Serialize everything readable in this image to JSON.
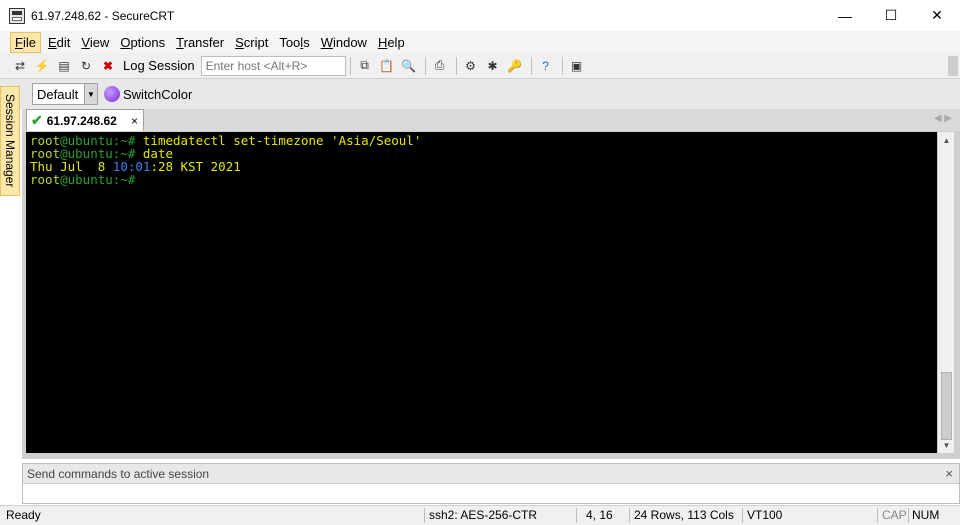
{
  "window": {
    "title": "61.97.248.62 - SecureCRT",
    "minimize": "—",
    "maximize": "☐",
    "close": "✕"
  },
  "menu": [
    {
      "label": "File",
      "underline": "F",
      "rest": "ile"
    },
    {
      "label": "Edit",
      "underline": "E",
      "rest": "dit"
    },
    {
      "label": "View",
      "underline": "V",
      "rest": "iew"
    },
    {
      "label": "Options",
      "underline": "O",
      "rest": "ptions"
    },
    {
      "label": "Transfer",
      "underline": "T",
      "rest": "ransfer"
    },
    {
      "label": "Script",
      "underline": "S",
      "rest": "cript"
    },
    {
      "label": "Tools",
      "underline": "l",
      "rest": ""
    },
    {
      "label": "Window",
      "underline": "W",
      "rest": "indow"
    },
    {
      "label": "Help",
      "underline": "H",
      "rest": "elp"
    }
  ],
  "toolbar": {
    "log_session": "Log Session",
    "host_placeholder": "Enter host <Alt+R>"
  },
  "buttonbar": {
    "default_label": "Default",
    "switchcolor": "SwitchColor"
  },
  "side": {
    "session_manager": "Session Manager"
  },
  "tab": {
    "label": "61.97.248.62",
    "close": "×"
  },
  "terminal": {
    "lines": [
      {
        "user": "root",
        "host": "@ubuntu:~#",
        "cmd": " timedatectl set-timezone 'Asia/Seoul'"
      },
      {
        "user": "root",
        "host": "@ubuntu:~#",
        "cmd": " date"
      },
      {
        "date_pre": "Thu Jul  8 ",
        "date_time": "10:01",
        "date_post": ":28 KST 2021"
      },
      {
        "user": "root",
        "host": "@ubuntu:~#",
        "cmd": ""
      }
    ]
  },
  "command_window": {
    "header": "Send commands to active session",
    "close": "×"
  },
  "status": {
    "ready": "Ready",
    "cipher": "ssh2: AES-256-CTR",
    "position": "4,  16",
    "size": "24 Rows, 113 Cols",
    "emulation": "VT100",
    "cap": "CAP",
    "num": "NUM"
  }
}
